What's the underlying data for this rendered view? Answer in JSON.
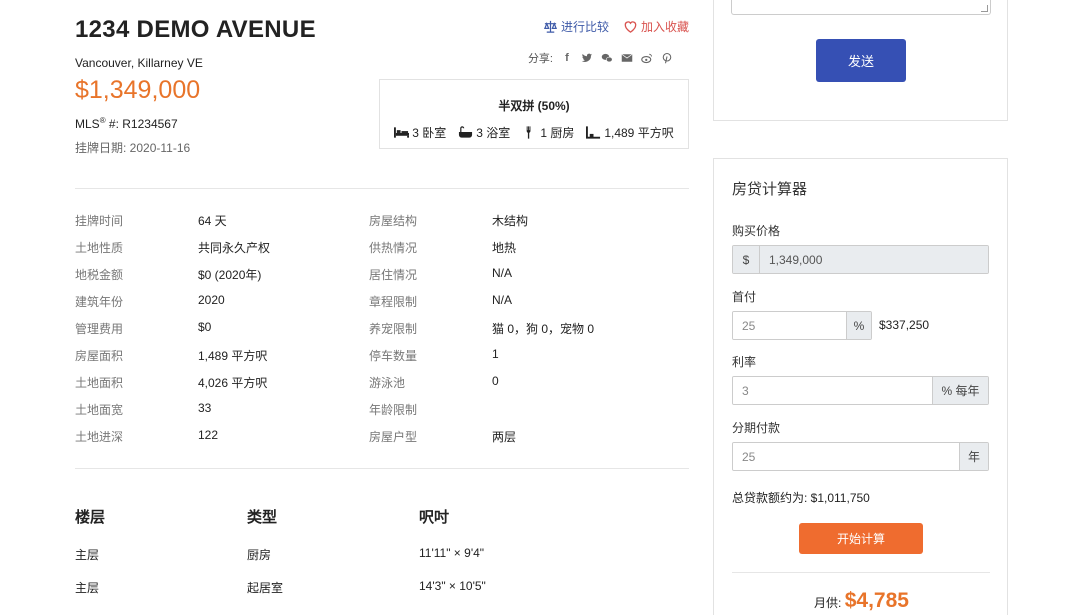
{
  "listing": {
    "title": "1234 DEMO AVENUE",
    "location": "Vancouver,  Killarney VE",
    "price": "$1,349,000",
    "mls_label": "MLS",
    "mls_sup": "®",
    "mls_value": " #: R1234567",
    "list_date": "挂牌日期: 2020-11-16"
  },
  "actions": {
    "compare": "进行比较",
    "favorite": "加入收藏",
    "share_label": "分享:",
    "share_icons": [
      "facebook-icon",
      "twitter-icon",
      "wechat-icon",
      "email-icon",
      "weibo-icon",
      "pinterest-icon"
    ]
  },
  "summary": {
    "property_type": "半双拼 (50%)",
    "beds": "3 卧室",
    "baths": "3 浴室",
    "kitchens": "1 厨房",
    "area": "1,489 平方呎"
  },
  "details": [
    {
      "l1": "挂牌时间",
      "v1": "64 天",
      "l2": "房屋结构",
      "v2": "木结构"
    },
    {
      "l1": "土地性质",
      "v1": "共同永久产权",
      "l2": "供热情况",
      "v2": "地热"
    },
    {
      "l1": "地税金额",
      "v1": "$0 (2020年)",
      "l2": "居住情况",
      "v2": "N/A"
    },
    {
      "l1": "建筑年份",
      "v1": "2020",
      "l2": "章程限制",
      "v2": "N/A"
    },
    {
      "l1": "管理费用",
      "v1": "$0",
      "l2": "养宠限制",
      "v2": "猫 0，狗 0，宠物 0"
    },
    {
      "l1": "房屋面积",
      "v1": "1,489 平方呎",
      "l2": "停车数量",
      "v2": "1"
    },
    {
      "l1": "土地面积",
      "v1": "4,026 平方呎",
      "l2": "游泳池",
      "v2": "0"
    },
    {
      "l1": "土地面宽",
      "v1": "33",
      "l2": "年龄限制",
      "v2": ""
    },
    {
      "l1": "土地进深",
      "v1": "122",
      "l2": "房屋户型",
      "v2": "两层"
    }
  ],
  "rooms": {
    "headers": [
      "楼层",
      "类型",
      "呎吋"
    ],
    "rows": [
      [
        "主层",
        "厨房",
        "11'11\" × 9'4\""
      ],
      [
        "主层",
        "起居室",
        "14'3\" × 10'5\""
      ]
    ]
  },
  "contact": {
    "send": "发送"
  },
  "calculator": {
    "title": "房贷计算器",
    "price_label": "购买价格",
    "price_prefix": "$",
    "price_value": "1,349,000",
    "down_label": "首付",
    "down_placeholder": "25",
    "down_suffix": "%",
    "down_amount": "$337,250",
    "rate_label": "利率",
    "rate_placeholder": "3",
    "rate_suffix": "% 每年",
    "term_label": "分期付款",
    "term_placeholder": "25",
    "term_suffix": "年",
    "total": "总贷款额约为: $1,011,750",
    "calc_button": "开始计算",
    "monthly_label": "月供: ",
    "monthly_value": "$4,785"
  },
  "colors": {
    "accent_orange": "#e8742a",
    "primary_blue": "#3650b4",
    "calc_button": "#ef6c2f"
  }
}
